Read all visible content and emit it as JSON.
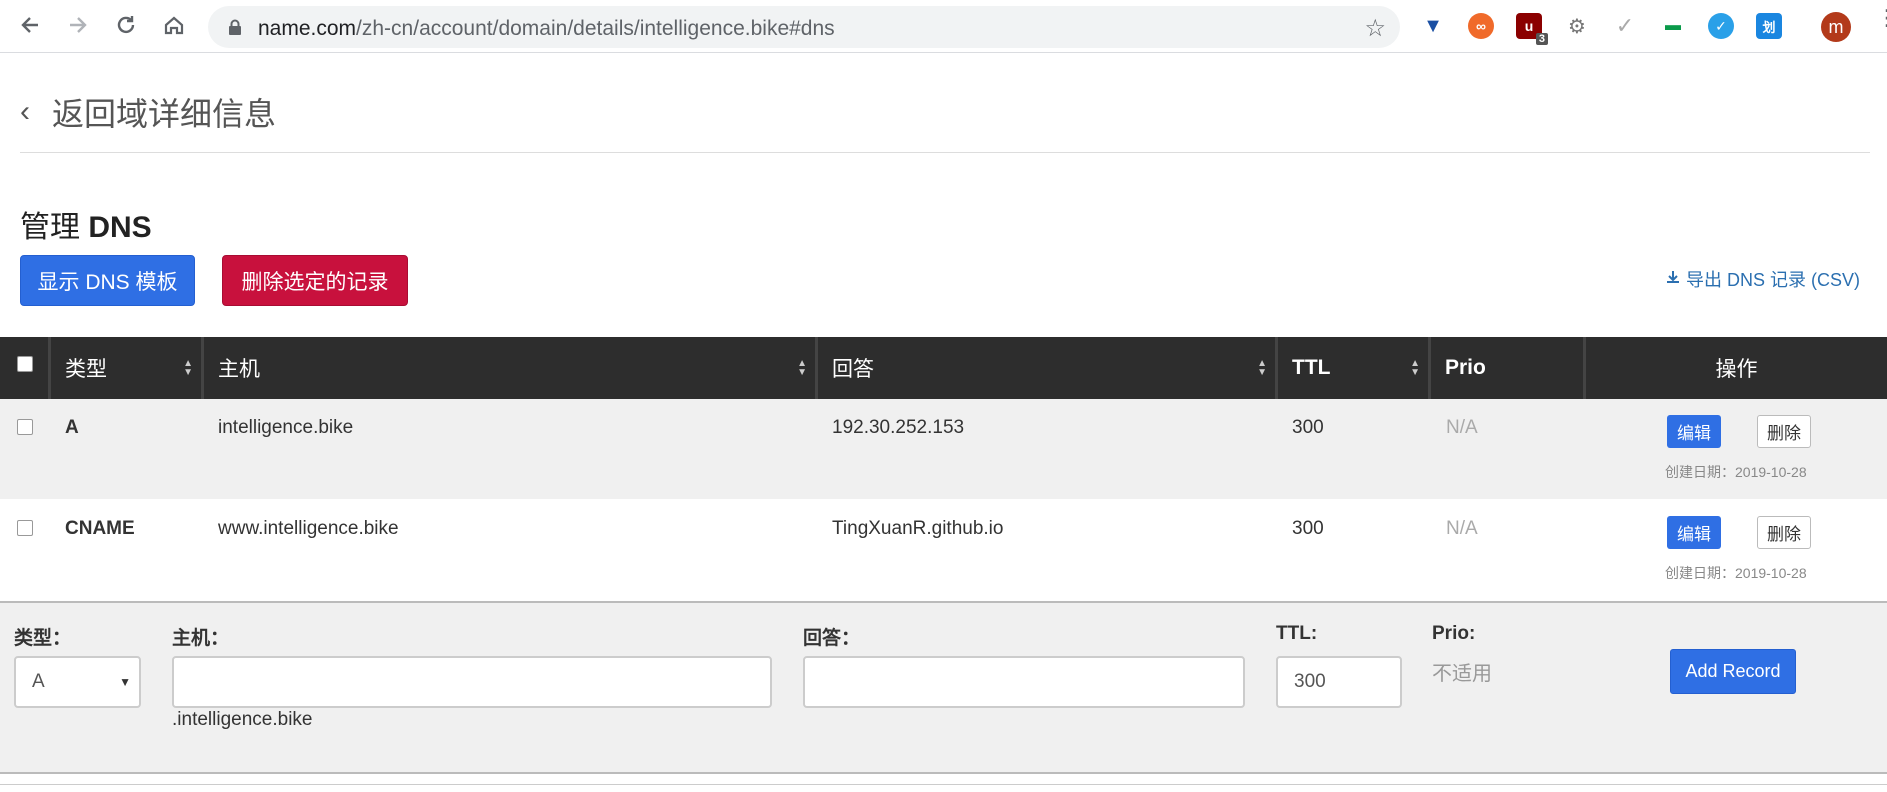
{
  "browser": {
    "url_host": "name.com",
    "url_path": "/zh-cn/account/domain/details/intelligence.bike#dns",
    "ext_badge": "3",
    "avatar_letter": "m"
  },
  "page": {
    "back_label": "返回域详细信息",
    "title_prefix": "管理",
    "title_bold": "DNS",
    "show_templates_label": "显示 DNS 模板",
    "delete_selected_label": "删除选定的记录",
    "export_label": "导出 DNS 记录 (CSV)"
  },
  "table": {
    "headers": {
      "type": "类型",
      "host": "主机",
      "answer": "回答",
      "ttl": "TTL",
      "prio": "Prio",
      "actions": "操作"
    },
    "rows": [
      {
        "type": "A",
        "host": "intelligence.bike",
        "answer": "192.30.252.153",
        "ttl": "300",
        "prio": "N/A",
        "edit_label": "编辑",
        "delete_label": "删除",
        "created": "创建日期：2019-10-28"
      },
      {
        "type": "CNAME",
        "host": "www.intelligence.bike",
        "answer": "TingXuanR.github.io",
        "ttl": "300",
        "prio": "N/A",
        "edit_label": "编辑",
        "delete_label": "删除",
        "created": "创建日期：2019-10-28"
      }
    ]
  },
  "form": {
    "type_label": "类型：",
    "type_value": "A",
    "host_label": "主机：",
    "host_value": "",
    "host_suffix": ".intelligence.bike",
    "answer_label": "回答：",
    "answer_value": "",
    "ttl_label": "TTL:",
    "ttl_value": "300",
    "prio_label": "Prio:",
    "prio_value": "不适用",
    "add_label": "Add Record"
  },
  "colors": {
    "primary": "#2f6fe4",
    "danger": "#c8113d",
    "header_bg": "#2d2d2d",
    "link": "#2b6fb0"
  }
}
